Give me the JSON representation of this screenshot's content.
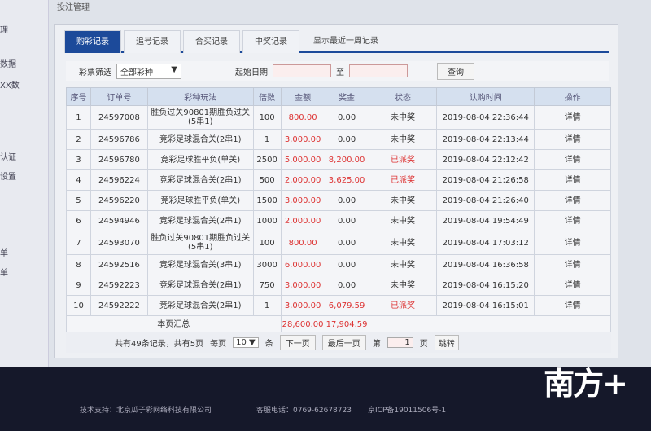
{
  "header": {
    "title": "投注管理"
  },
  "sidebar": {
    "items": [
      "理",
      "数据",
      "XX数",
      "认证",
      "设置",
      "单",
      "单"
    ]
  },
  "tabs": [
    "购彩记录",
    "追号记录",
    "合买记录",
    "中奖记录",
    "显示最近一周记录"
  ],
  "filter": {
    "lottery_label": "彩票筛选",
    "lottery_value": "全部彩种",
    "date_label": "起始日期",
    "to_label": "至",
    "search_label": "查询"
  },
  "table": {
    "headers": [
      "序号",
      "订单号",
      "彩种玩法",
      "倍数",
      "金额",
      "奖金",
      "状态",
      "认购时间",
      "操作"
    ],
    "rows": [
      [
        "1",
        "24597008",
        "胜负过关90801期胜负过关(5串1)",
        "100",
        "800.00",
        "0.00",
        "未中奖",
        "2019-08-04 22:36:44",
        "详情"
      ],
      [
        "2",
        "24596786",
        "竞彩足球混合关(2串1)",
        "1",
        "3,000.00",
        "0.00",
        "未中奖",
        "2019-08-04 22:13:44",
        "详情"
      ],
      [
        "3",
        "24596780",
        "竞彩足球胜平负(单关)",
        "2500",
        "5,000.00",
        "8,200.00",
        "已派奖",
        "2019-08-04 22:12:42",
        "详情"
      ],
      [
        "4",
        "24596224",
        "竞彩足球混合关(2串1)",
        "500",
        "2,000.00",
        "3,625.00",
        "已派奖",
        "2019-08-04 21:26:58",
        "详情"
      ],
      [
        "5",
        "24596220",
        "竞彩足球胜平负(单关)",
        "1500",
        "3,000.00",
        "0.00",
        "未中奖",
        "2019-08-04 21:26:40",
        "详情"
      ],
      [
        "6",
        "24594946",
        "竞彩足球混合关(2串1)",
        "1000",
        "2,000.00",
        "0.00",
        "未中奖",
        "2019-08-04 19:54:49",
        "详情"
      ],
      [
        "7",
        "24593070",
        "胜负过关90801期胜负过关(5串1)",
        "100",
        "800.00",
        "0.00",
        "未中奖",
        "2019-08-04 17:03:12",
        "详情"
      ],
      [
        "8",
        "24592516",
        "竞彩足球混合关(3串1)",
        "3000",
        "6,000.00",
        "0.00",
        "未中奖",
        "2019-08-04 16:36:58",
        "详情"
      ],
      [
        "9",
        "24592223",
        "竞彩足球混合关(2串1)",
        "750",
        "3,000.00",
        "0.00",
        "未中奖",
        "2019-08-04 16:15:20",
        "详情"
      ],
      [
        "10",
        "24592222",
        "竞彩足球混合关(2串1)",
        "1",
        "3,000.00",
        "6,079.59",
        "已派奖",
        "2019-08-04 16:15:01",
        "详情"
      ]
    ],
    "summary": {
      "label": "本页汇总",
      "amount": "28,600.00",
      "prize": "17,904.59"
    }
  },
  "pager": {
    "total_text": "共有49条记录，共有5页",
    "per_page_label": "每页",
    "per_page_value": "10",
    "unit": "条",
    "next": "下一页",
    "last": "最后一页",
    "page_label": "第",
    "page_value": "1",
    "page_unit": "页",
    "go": "跳转"
  },
  "footer": {
    "support": "技术支持：北京瓜子彩网络科技有限公司",
    "phone": "客服电话：0769-62678723",
    "icp": "京ICP备19011506号-1"
  },
  "watermark": "南方+"
}
